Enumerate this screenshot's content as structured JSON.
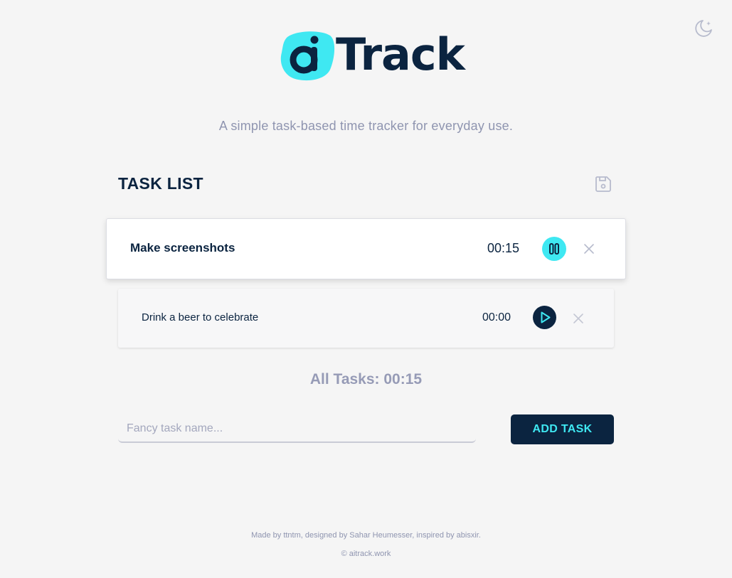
{
  "app": {
    "logo_text": "Track",
    "tagline": "A simple task-based time tracker for everyday use."
  },
  "header": {
    "theme_toggle_icon": "moon-icon"
  },
  "task_list": {
    "title": "TASK LIST",
    "save_icon": "save-icon",
    "tasks": [
      {
        "name": "Make screenshots",
        "time": "00:15",
        "state": "running",
        "control_icon": "pause-icon"
      },
      {
        "name": "Drink a beer to celebrate",
        "time": "00:00",
        "state": "paused",
        "control_icon": "play-icon"
      }
    ],
    "total": "All Tasks: 00:15"
  },
  "new_task": {
    "placeholder": "Fancy task name...",
    "value": "",
    "button_label": "ADD TASK"
  },
  "footer": {
    "credit": "Made by ttntm, designed by Sahar Heumesser, inspired by abisxir.",
    "copyright": "© aitrack.work"
  },
  "colors": {
    "background": "#f5f5f5",
    "primary": "#0b2440",
    "accent": "#3fe8f2",
    "muted": "#8f95b0"
  }
}
